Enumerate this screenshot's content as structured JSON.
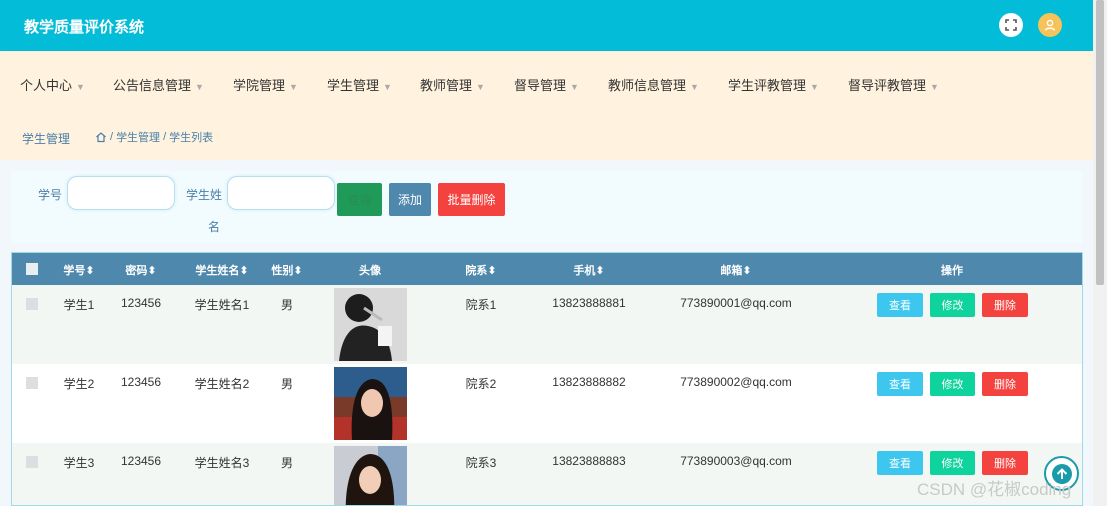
{
  "app": {
    "title": "教学质量评价系统"
  },
  "nav": [
    {
      "label": "个人中心"
    },
    {
      "label": "公告信息管理"
    },
    {
      "label": "学院管理"
    },
    {
      "label": "学生管理"
    },
    {
      "label": "教师管理"
    },
    {
      "label": "督导管理"
    },
    {
      "label": "教师信息管理"
    },
    {
      "label": "学生评教管理"
    },
    {
      "label": "督导评教管理"
    }
  ],
  "breadcrumb": {
    "title": "学生管理",
    "path": "学生管理",
    "current": "学生列表",
    "sep": "/"
  },
  "search": {
    "student_no_label": "学号",
    "student_name_label_1": "学生姓",
    "student_name_label_2": "名",
    "student_no_value": "",
    "student_name_value": "",
    "search_button": "查询",
    "add_button": "添加",
    "batch_delete_button": "批量删除"
  },
  "table": {
    "headers": [
      "学号",
      "密码",
      "学生姓名",
      "性别",
      "头像",
      "院系",
      "手机",
      "邮箱",
      "操作"
    ],
    "sortable": [
      "学号",
      "密码",
      "学生姓名",
      "性别",
      "院系",
      "手机",
      "邮箱"
    ],
    "rows": [
      {
        "student_no": "学生1",
        "password": "123456",
        "name": "学生姓名1",
        "gender": "男",
        "dept": "院系1",
        "phone": "13823888881",
        "email": "773890001@qq.com"
      },
      {
        "student_no": "学生2",
        "password": "123456",
        "name": "学生姓名2",
        "gender": "男",
        "dept": "院系2",
        "phone": "13823888882",
        "email": "773890002@qq.com"
      },
      {
        "student_no": "学生3",
        "password": "123456",
        "name": "学生姓名3",
        "gender": "男",
        "dept": "院系3",
        "phone": "13823888883",
        "email": "773890003@qq.com"
      }
    ],
    "actions": {
      "view": "查看",
      "edit": "修改",
      "delete": "删除"
    }
  },
  "watermark": "CSDN @花椒coding",
  "colors": {
    "header": "#03bcd7",
    "nav_bg": "#fff2de",
    "table_head": "#4f88ad",
    "view": "#3ec7ee",
    "edit": "#0fd39c",
    "delete": "#f4433f"
  },
  "icons": [
    "fullscreen-icon",
    "user-avatar-icon",
    "home-icon",
    "sort-icon",
    "back-to-top-icon"
  ]
}
